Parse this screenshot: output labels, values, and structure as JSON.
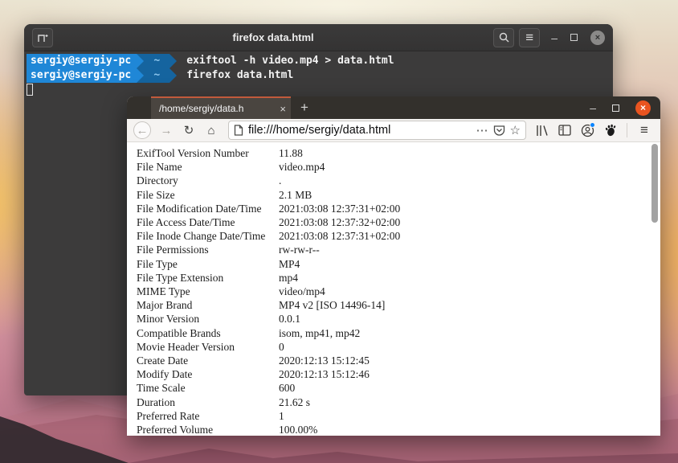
{
  "terminal": {
    "title": "firefox data.html",
    "controls": {
      "minimize": "–",
      "close": "×"
    },
    "menu_glyph": "≡",
    "lines": [
      {
        "user": "sergiy@sergiy-pc",
        "path": "~",
        "command": "exiftool -h video.mp4 > data.html"
      },
      {
        "user": "sergiy@sergiy-pc",
        "path": "~",
        "command": "firefox data.html"
      }
    ]
  },
  "browser": {
    "tab_title": "/home/sergiy/data.h",
    "tab_close": "×",
    "new_tab": "+",
    "controls": {
      "minimize": "–",
      "close": "×"
    },
    "nav": {
      "back": "←",
      "forward": "→",
      "reload": "↻",
      "home": "⌂"
    },
    "urlbar": {
      "url": "file:///home/sergiy/data.html",
      "page_actions": "⋯",
      "bookmark": "☆"
    },
    "menu_glyph": "≡"
  },
  "page": {
    "rows": [
      {
        "label": "ExifTool Version Number",
        "value": "11.88"
      },
      {
        "label": "File Name",
        "value": "video.mp4"
      },
      {
        "label": "Directory",
        "value": "."
      },
      {
        "label": "File Size",
        "value": "2.1 MB"
      },
      {
        "label": "File Modification Date/Time",
        "value": "2021:03:08 12:37:31+02:00"
      },
      {
        "label": "File Access Date/Time",
        "value": "2021:03:08 12:37:32+02:00"
      },
      {
        "label": "File Inode Change Date/Time",
        "value": "2021:03:08 12:37:31+02:00"
      },
      {
        "label": "File Permissions",
        "value": "rw-rw-r--"
      },
      {
        "label": "File Type",
        "value": "MP4"
      },
      {
        "label": "File Type Extension",
        "value": "mp4"
      },
      {
        "label": "MIME Type",
        "value": "video/mp4"
      },
      {
        "label": "Major Brand",
        "value": "MP4 v2 [ISO 14496-14]"
      },
      {
        "label": "Minor Version",
        "value": "0.0.1"
      },
      {
        "label": "Compatible Brands",
        "value": "isom, mp41, mp42"
      },
      {
        "label": "Movie Header Version",
        "value": "0"
      },
      {
        "label": "Create Date",
        "value": "2020:12:13 15:12:45"
      },
      {
        "label": "Modify Date",
        "value": "2020:12:13 15:12:46"
      },
      {
        "label": "Time Scale",
        "value": "600"
      },
      {
        "label": "Duration",
        "value": "21.62 s"
      },
      {
        "label": "Preferred Rate",
        "value": "1"
      },
      {
        "label": "Preferred Volume",
        "value": "100.00%"
      }
    ]
  },
  "colors": {
    "prompt_blue": "#1f87d7",
    "prompt_blue_dark": "#15649f",
    "tab_accent": "#c15a3c",
    "close_button": "#e95420",
    "notification_dot": "#0a84ff"
  }
}
